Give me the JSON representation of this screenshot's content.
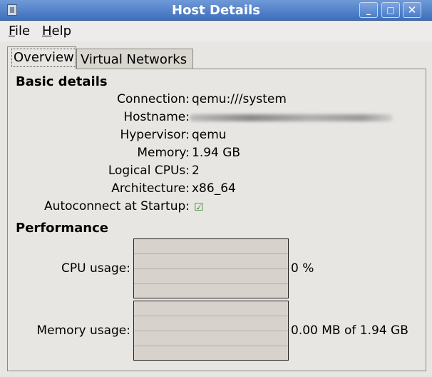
{
  "window": {
    "title": "Host Details",
    "controls": {
      "minimize": "_",
      "maximize": "□",
      "close": "✕"
    }
  },
  "menu": {
    "file": {
      "mnemonic": "F",
      "rest": "ile"
    },
    "help": {
      "mnemonic": "H",
      "rest": "elp"
    }
  },
  "tabs": {
    "overview": "Overview",
    "virtual_networks": "Virtual Networks"
  },
  "basic_details": {
    "title": "Basic details",
    "connection": {
      "label": "Connection:",
      "value": "qemu:///system"
    },
    "hostname": {
      "label": "Hostname:",
      "value": ""
    },
    "hypervisor": {
      "label": "Hypervisor:",
      "value": "qemu"
    },
    "memory": {
      "label": "Memory:",
      "value": "1.94 GB"
    },
    "logical_cpus": {
      "label": "Logical CPUs:",
      "value": "2"
    },
    "architecture": {
      "label": "Architecture:",
      "value": "x86_64"
    },
    "autoconnect": {
      "label": "Autoconnect at Startup:",
      "checked": true,
      "glyph": "☑"
    }
  },
  "performance": {
    "title": "Performance",
    "cpu": {
      "label": "CPU usage:",
      "value": "0 %",
      "fraction": 0
    },
    "memory": {
      "label": "Memory usage:",
      "value": "0.00 MB of 1.94 GB",
      "fraction": 0
    }
  },
  "colors": {
    "titlebar": "#4a7cc7",
    "graph_bg": "#d7d2cc",
    "checkbox": "#3a8a2a"
  }
}
